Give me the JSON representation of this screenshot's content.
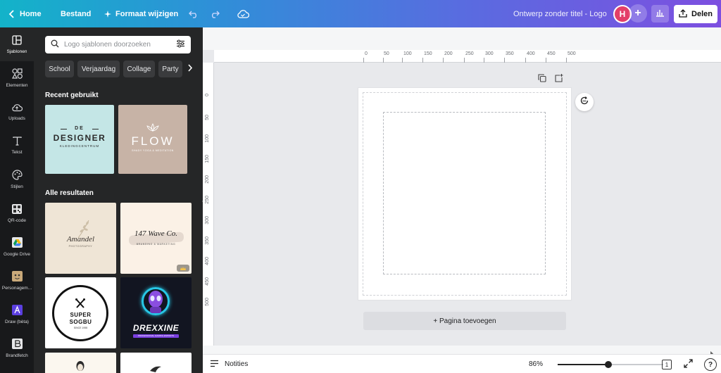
{
  "topbar": {
    "home_label": "Home",
    "file_label": "Bestand",
    "resize_label": "Formaat wijzigen",
    "design_title": "Ontwerp zonder titel - Logo",
    "avatar_initial": "H",
    "share_label": "Delen",
    "gradient_start": "#13b3c9",
    "gradient_end": "#7d4fe0"
  },
  "rail": {
    "items": [
      {
        "label": "Sjablonen",
        "icon": "templates-icon"
      },
      {
        "label": "Elementen",
        "icon": "elements-icon"
      },
      {
        "label": "Uploads",
        "icon": "upload-cloud-icon"
      },
      {
        "label": "Tekst",
        "icon": "text-icon"
      },
      {
        "label": "Stijlen",
        "icon": "palette-icon"
      },
      {
        "label": "QR-code",
        "icon": "qr-code-icon"
      },
      {
        "label": "Google Drive",
        "icon": "google-drive-icon"
      },
      {
        "label": "Personagem...",
        "icon": "character-icon"
      },
      {
        "label": "Draw (bèta)",
        "icon": "draw-icon"
      },
      {
        "label": "Brandfetch",
        "icon": "brandfetch-icon"
      }
    ]
  },
  "panel": {
    "search_placeholder": "Logo sjablonen doorzoeken",
    "chips": [
      "School",
      "Verjaardag",
      "Collage",
      "Party"
    ],
    "recent_title": "Recent gebruikt",
    "results_title": "Alle resultaten",
    "recent": [
      {
        "line1": "DE",
        "line2": "DESIGNER",
        "line3": "KLEDINGCENTRUM"
      },
      {
        "line1": "FLOW",
        "line2": "SHADY YOGA & MEDITATION"
      }
    ],
    "results": [
      {
        "text": "Amandel",
        "sub": "PHOTOGRAPHY"
      },
      {
        "text": "147 Wave Co.",
        "sub": "BRANDING & MARKETING"
      },
      {
        "line1": "SUPER",
        "line2": "SOGBU",
        "sub": "SINCE 1955"
      },
      {
        "text": "DREXXINE",
        "sub": "PROFESSIONAL GAMING ESPORTS"
      }
    ]
  },
  "ruler": {
    "h_labels": [
      "0",
      "50",
      "100",
      "150",
      "200",
      "250",
      "300",
      "350",
      "400",
      "450",
      "500"
    ],
    "v_labels": [
      "0",
      "50",
      "100",
      "150",
      "200",
      "250",
      "300",
      "350",
      "400",
      "450",
      "500"
    ]
  },
  "canvas": {
    "add_page_label": "+ Pagina toevoegen"
  },
  "bottombar": {
    "notes_label": "Notities",
    "zoom": "86%",
    "zoom_fraction": 0.48,
    "page_count": "1",
    "help": "?"
  }
}
